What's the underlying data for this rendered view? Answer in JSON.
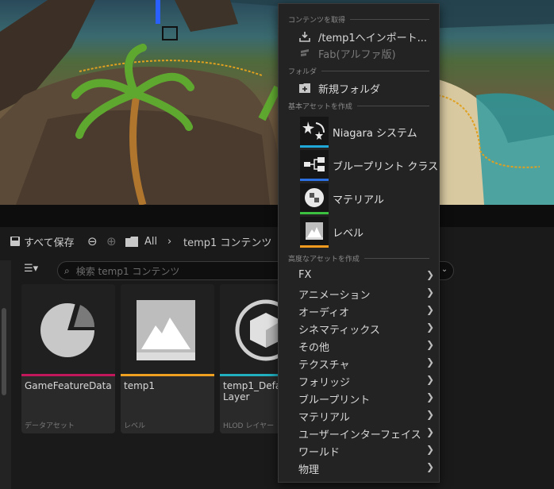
{
  "toolbar": {
    "save_all": "すべて保存",
    "breadcrumb_root": "All",
    "breadcrumb_current": "temp1 コンテンツ"
  },
  "search": {
    "placeholder": "検索 temp1 コンテンツ"
  },
  "assets": [
    {
      "name": "GameFeatureData",
      "type": "データアセット",
      "color": "#c2185b"
    },
    {
      "name": "temp1",
      "type": "レベル",
      "color": "#f0a020"
    },
    {
      "name": "temp1_Default Layer",
      "type": "HLOD レイヤー",
      "color": "#20b0c0"
    }
  ],
  "menu": {
    "sections": {
      "get_content": "コンテンツを取得",
      "folder": "フォルダ",
      "basic_assets": "基本アセットを作成",
      "advanced_assets": "高度なアセットを作成"
    },
    "import_label": "/temp1へインポート...",
    "fab_label": "Fab(アルファ版)",
    "new_folder": "新規フォルダ",
    "basic": [
      {
        "label": "Niagara システム",
        "color": "#1fa8d8"
      },
      {
        "label": "ブループリント クラス",
        "color": "#2c6fe0"
      },
      {
        "label": "マテリアル",
        "color": "#3cc040"
      },
      {
        "label": "レベル",
        "color": "#f09a20"
      }
    ],
    "advanced": [
      "FX",
      "アニメーション",
      "オーディオ",
      "シネマティックス",
      "その他",
      "テクスチャ",
      "フォリッジ",
      "ブループリント",
      "マテリアル",
      "ユーザーインターフェイス",
      "ワールド",
      "物理"
    ]
  }
}
